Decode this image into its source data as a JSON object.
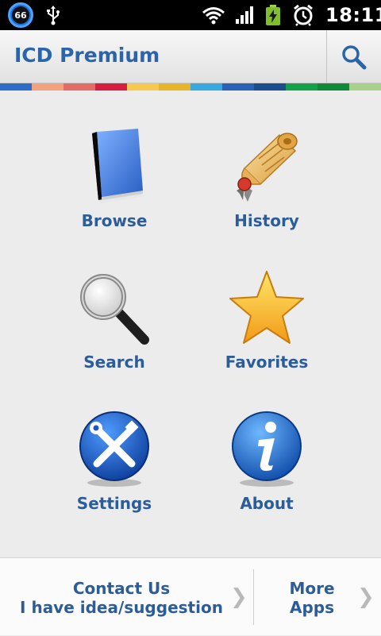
{
  "statusbar": {
    "badge": "66",
    "time": "18:11",
    "icons": [
      "usb-icon",
      "wifi-icon",
      "signal-icon",
      "battery-charging-icon",
      "alarm-icon"
    ]
  },
  "actionbar": {
    "title": "ICD Premium",
    "search_icon": "search-icon"
  },
  "colors": {
    "accent": "#2c5d99",
    "strip": [
      "#2d6cc9",
      "#f2a27e",
      "#e36b67",
      "#d71d3e",
      "#f6c84f",
      "#e8b52a",
      "#36a9e0",
      "#2a62b8",
      "#1c4d8e",
      "#12a34a",
      "#0f8a3a",
      "#a8d28a"
    ]
  },
  "menu": {
    "browse": "Browse",
    "history": "History",
    "search": "Search",
    "favorites": "Favorites",
    "settings": "Settings",
    "about": "About"
  },
  "footer": {
    "contact_line1": "Contact Us",
    "contact_line2": "I have idea/suggestion",
    "more_line1": "More",
    "more_line2": "Apps",
    "chevron": "❯"
  }
}
